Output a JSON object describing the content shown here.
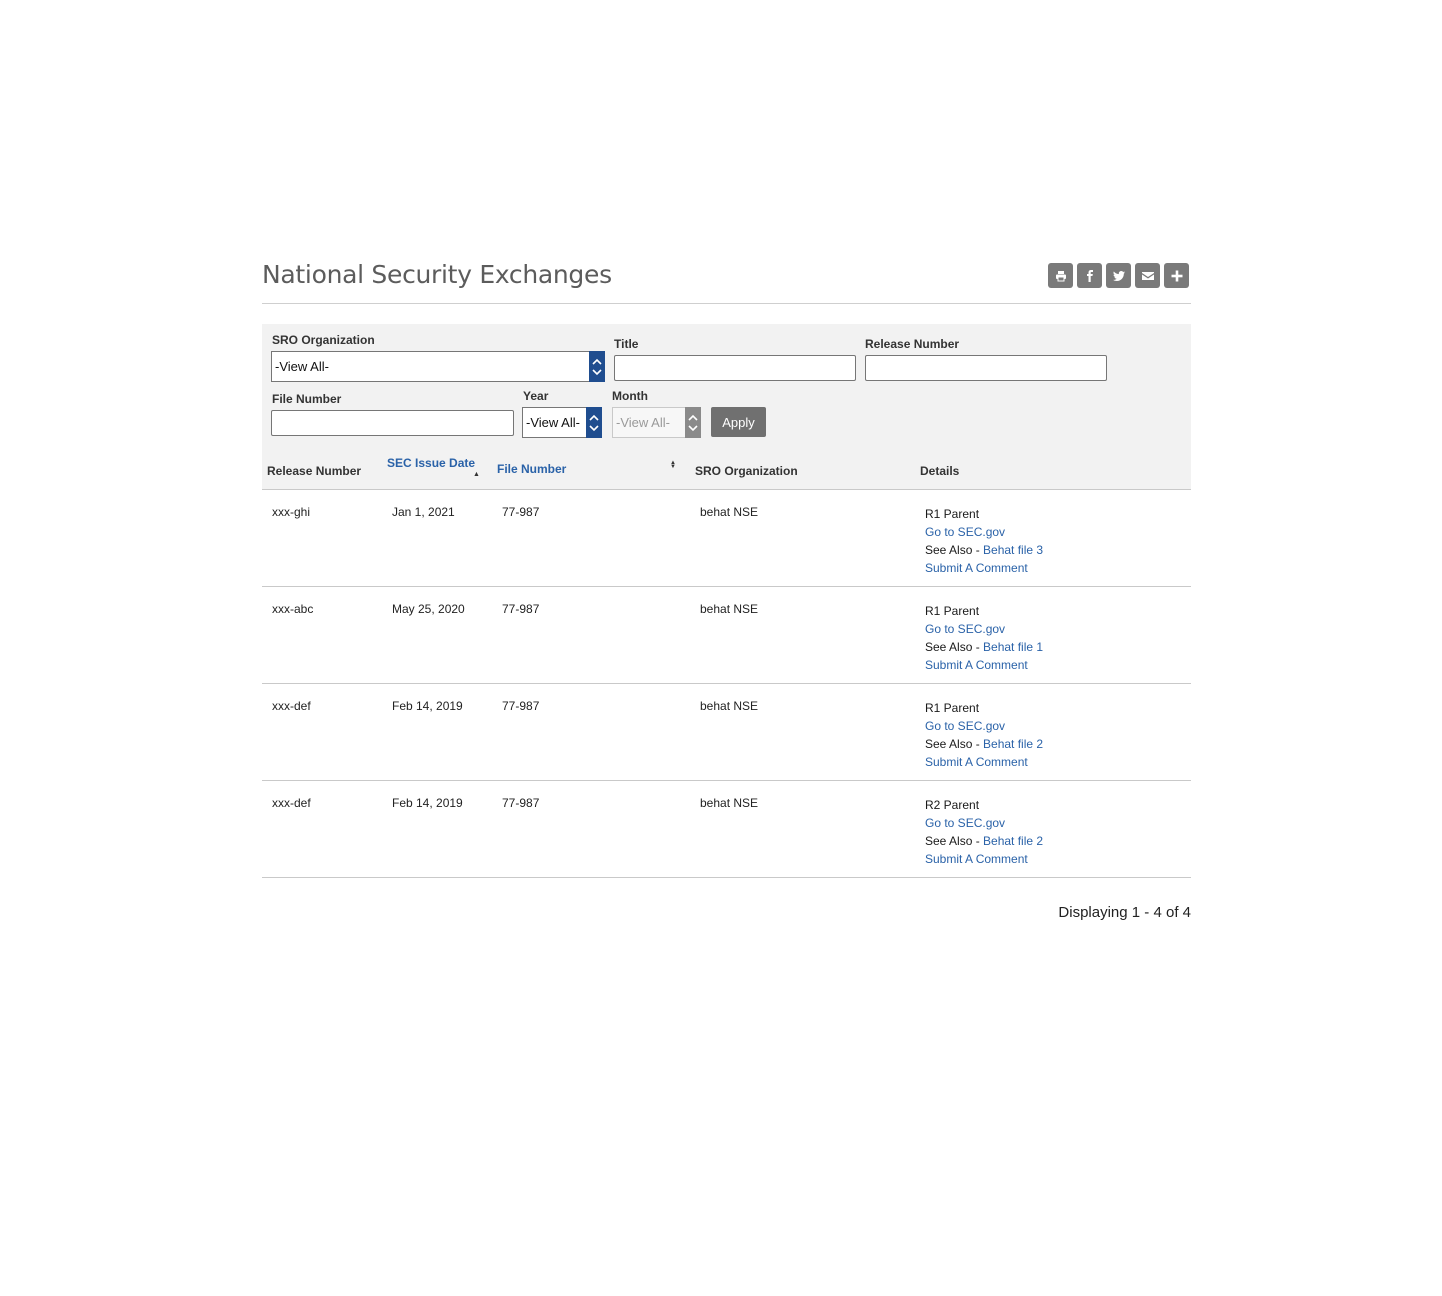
{
  "page": {
    "title": "National Security Exchanges"
  },
  "share": [
    {
      "name": "print-icon"
    },
    {
      "name": "facebook-icon"
    },
    {
      "name": "twitter-icon"
    },
    {
      "name": "email-icon"
    },
    {
      "name": "plus-icon"
    }
  ],
  "filters": {
    "sro_label": "SRO Organization",
    "sro_value": "-View All-",
    "title_label": "Title",
    "title_value": "",
    "release_label": "Release Number",
    "release_value": "",
    "file_label": "File Number",
    "file_value": "",
    "year_label": "Year",
    "year_value": "-View All-",
    "month_label": "Month",
    "month_value": "-View All-",
    "apply_label": "Apply"
  },
  "table": {
    "headers": {
      "release": "Release Number",
      "date": "SEC Issue Date",
      "file": "File Number",
      "sro": "SRO Organization",
      "details": "Details"
    },
    "rows": [
      {
        "release": "xxx-ghi",
        "date": "Jan 1, 2021",
        "file": "77-987",
        "sro": "behat NSE",
        "parent": "R1 Parent",
        "goto": "Go to SEC.gov",
        "see_also": "See Also - ",
        "see_link": "Behat file 3",
        "comment": "Submit A Comment"
      },
      {
        "release": "xxx-abc",
        "date": "May 25, 2020",
        "file": "77-987",
        "sro": "behat NSE",
        "parent": "R1 Parent",
        "goto": "Go to SEC.gov",
        "see_also": "See Also - ",
        "see_link": "Behat file 1",
        "comment": "Submit A Comment"
      },
      {
        "release": "xxx-def",
        "date": "Feb 14, 2019",
        "file": "77-987",
        "sro": "behat NSE",
        "parent": "R1 Parent",
        "goto": "Go to SEC.gov",
        "see_also": "See Also - ",
        "see_link": "Behat file 2",
        "comment": "Submit A Comment"
      },
      {
        "release": "xxx-def",
        "date": "Feb 14, 2019",
        "file": "77-987",
        "sro": "behat NSE",
        "parent": "R2 Parent",
        "goto": "Go to SEC.gov",
        "see_also": "See Also - ",
        "see_link": "Behat file 2",
        "comment": "Submit A Comment"
      }
    ]
  },
  "footer": {
    "count": "Displaying 1 - 4 of 4"
  }
}
